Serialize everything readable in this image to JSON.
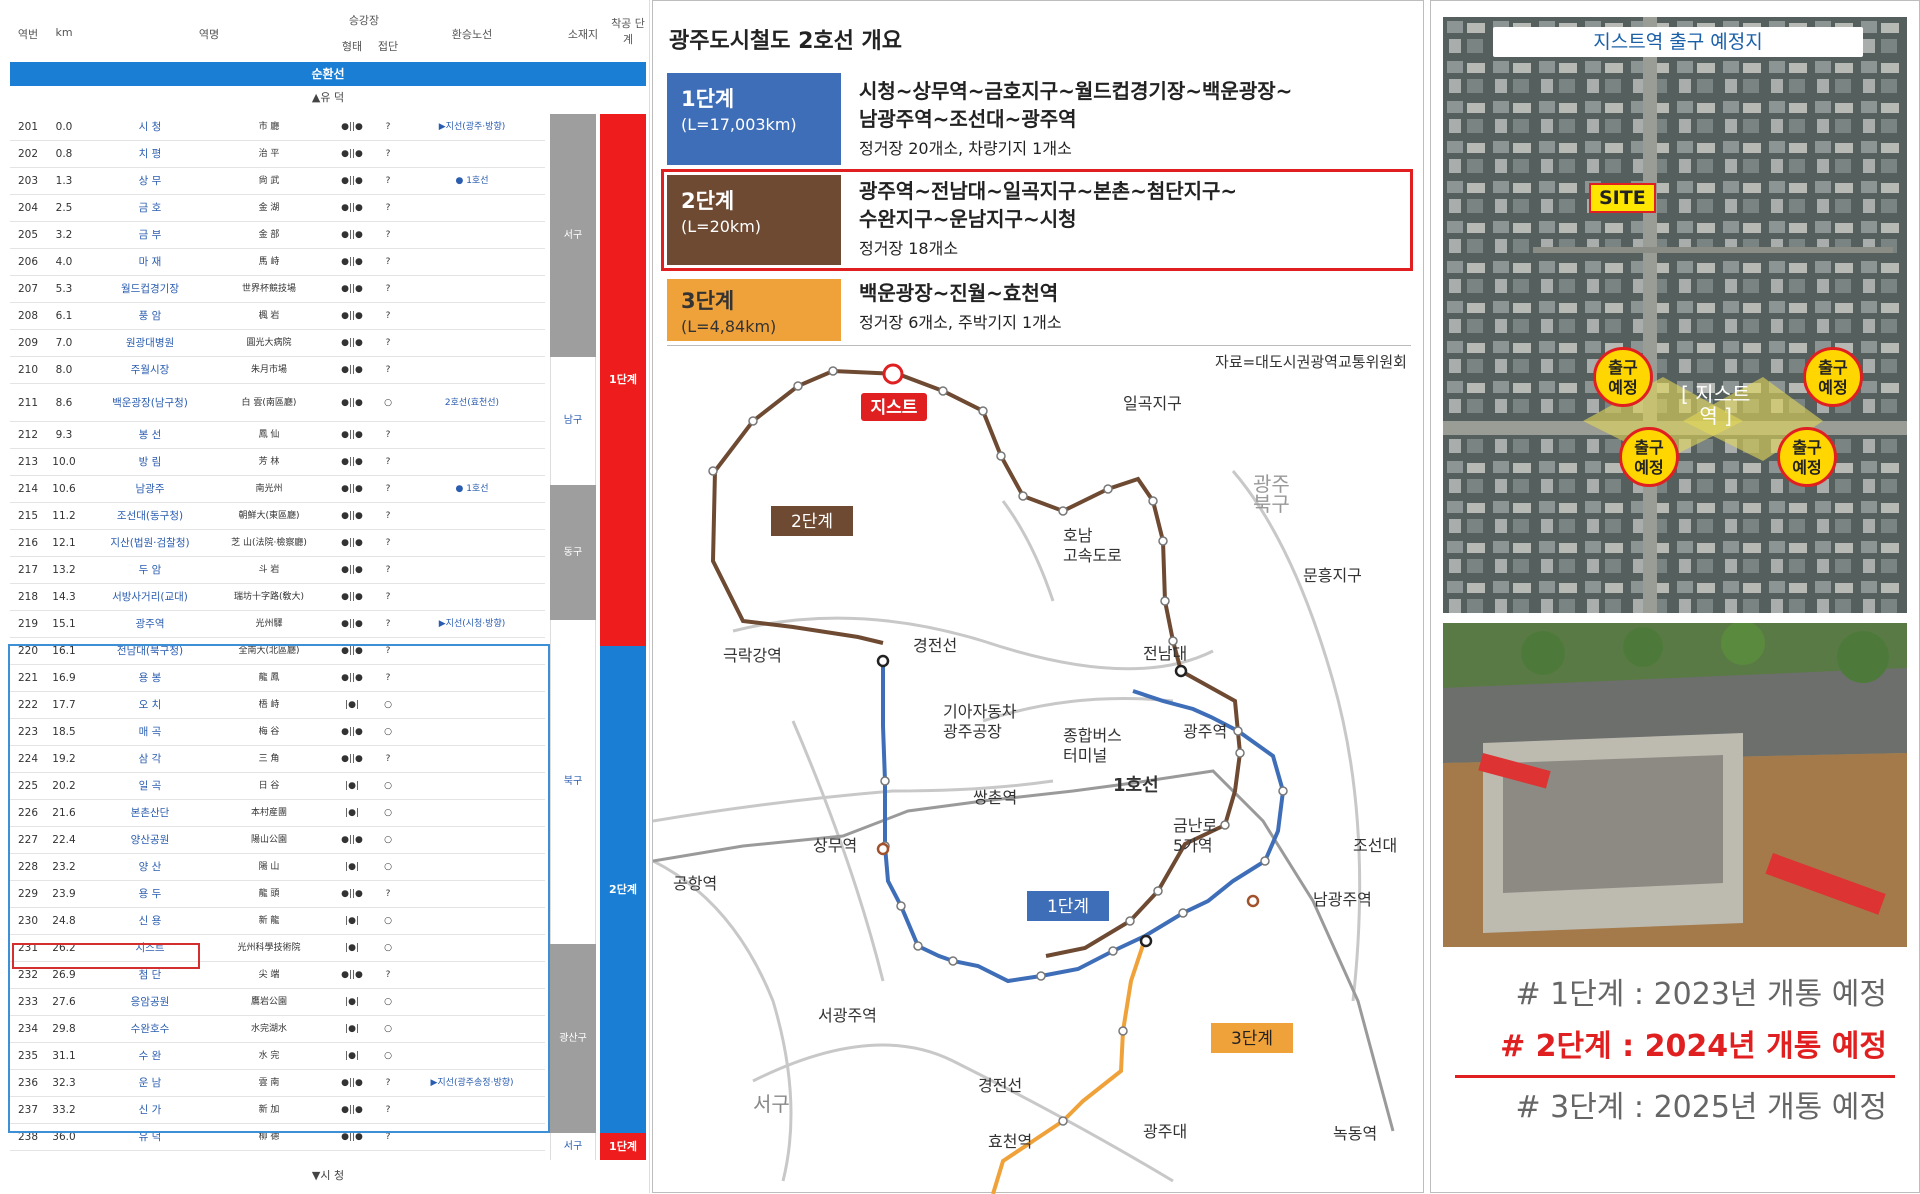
{
  "table": {
    "headers": {
      "no": "역번",
      "km": "km",
      "name": "역명",
      "platform": "승강장",
      "platform_a": "형태",
      "platform_b": "접단",
      "transfer": "환승노선",
      "district": "소재지",
      "stage": "착공 단계"
    },
    "loop_band": "순환선",
    "direction_top": "▲유 덕",
    "direction_bottom": "▼시 청",
    "rows": [
      {
        "no": "201",
        "km": "0.0",
        "name": "시 청",
        "hanja": "市 廳",
        "stop": "●||●",
        "q": "?",
        "tr": "▶지선(광주·방향)"
      },
      {
        "no": "202",
        "km": "0.8",
        "name": "치 평",
        "hanja": "治 平",
        "stop": "●||●",
        "q": "?",
        "tr": ""
      },
      {
        "no": "203",
        "km": "1.3",
        "name": "상 무",
        "hanja": "尙 武",
        "stop": "●||●",
        "q": "?",
        "tr": "● 1호선"
      },
      {
        "no": "204",
        "km": "2.5",
        "name": "금 호",
        "hanja": "金 湖",
        "stop": "●||●",
        "q": "?",
        "tr": ""
      },
      {
        "no": "205",
        "km": "3.2",
        "name": "금 부",
        "hanja": "金 部",
        "stop": "●||●",
        "q": "?",
        "tr": ""
      },
      {
        "no": "206",
        "km": "4.0",
        "name": "마 재",
        "hanja": "馬 峙",
        "stop": "●||●",
        "q": "?",
        "tr": ""
      },
      {
        "no": "207",
        "km": "5.3",
        "name": "월드컵경기장",
        "hanja": "世界杯競技場",
        "stop": "●||●",
        "q": "?",
        "tr": ""
      },
      {
        "no": "208",
        "km": "6.1",
        "name": "풍 암",
        "hanja": "楓 岩",
        "stop": "●||●",
        "q": "?",
        "tr": ""
      },
      {
        "no": "209",
        "km": "7.0",
        "name": "원광대병원",
        "hanja": "圓光大病院",
        "stop": "●||●",
        "q": "?",
        "tr": ""
      },
      {
        "no": "210",
        "km": "8.0",
        "name": "주월시장",
        "hanja": "朱月市場",
        "stop": "●||●",
        "q": "?",
        "tr": ""
      },
      {
        "no": "211",
        "km": "8.6",
        "name": "백운광장(남구청)",
        "hanja": "白 雲(南區廳)",
        "stop": "●||●",
        "q": "○",
        "tr": "2호선(효천선)"
      },
      {
        "no": "212",
        "km": "9.3",
        "name": "봉 선",
        "hanja": "鳳 仙",
        "stop": "●||●",
        "q": "?",
        "tr": ""
      },
      {
        "no": "213",
        "km": "10.0",
        "name": "방 림",
        "hanja": "芳 林",
        "stop": "●||●",
        "q": "?",
        "tr": ""
      },
      {
        "no": "214",
        "km": "10.6",
        "name": "남광주",
        "hanja": "南光州",
        "stop": "●||●",
        "q": "?",
        "tr": "● 1호선"
      },
      {
        "no": "215",
        "km": "11.2",
        "name": "조선대(동구청)",
        "hanja": "朝鮮大(東區廳)",
        "stop": "●||●",
        "q": "?",
        "tr": ""
      },
      {
        "no": "216",
        "km": "12.1",
        "name": "지산(법원·검찰청)",
        "hanja": "芝 山(法院·檢察廳)",
        "stop": "●||●",
        "q": "?",
        "tr": ""
      },
      {
        "no": "217",
        "km": "13.2",
        "name": "두 암",
        "hanja": "斗 岩",
        "stop": "●||●",
        "q": "?",
        "tr": ""
      },
      {
        "no": "218",
        "km": "14.3",
        "name": "서방사거리(교대)",
        "hanja": "瑞坊十字路(敎大)",
        "stop": "●||●",
        "q": "?",
        "tr": ""
      },
      {
        "no": "219",
        "km": "15.1",
        "name": "광주역",
        "hanja": "光州驛",
        "stop": "●||●",
        "q": "?",
        "tr": "▶지선(시청·방향)"
      },
      {
        "no": "220",
        "km": "16.1",
        "name": "전남대(북구청)",
        "hanja": "全南大(北區廳)",
        "stop": "●||●",
        "q": "?",
        "tr": ""
      },
      {
        "no": "221",
        "km": "16.9",
        "name": "용 봉",
        "hanja": "龍 鳳",
        "stop": "●||●",
        "q": "?",
        "tr": ""
      },
      {
        "no": "222",
        "km": "17.7",
        "name": "오 치",
        "hanja": "梧 峙",
        "stop": "|●|",
        "q": "○",
        "tr": ""
      },
      {
        "no": "223",
        "km": "18.5",
        "name": "매 곡",
        "hanja": "梅 谷",
        "stop": "●||●",
        "q": "○",
        "tr": ""
      },
      {
        "no": "224",
        "km": "19.2",
        "name": "삼 각",
        "hanja": "三 角",
        "stop": "●||●",
        "q": "?",
        "tr": ""
      },
      {
        "no": "225",
        "km": "20.2",
        "name": "일 곡",
        "hanja": "日 谷",
        "stop": "|●|",
        "q": "○",
        "tr": ""
      },
      {
        "no": "226",
        "km": "21.6",
        "name": "본촌산단",
        "hanja": "本村産團",
        "stop": "|●|",
        "q": "○",
        "tr": ""
      },
      {
        "no": "227",
        "km": "22.4",
        "name": "양산공원",
        "hanja": "陽山公園",
        "stop": "●||●",
        "q": "○",
        "tr": ""
      },
      {
        "no": "228",
        "km": "23.2",
        "name": "양 산",
        "hanja": "陽 山",
        "stop": "|●|",
        "q": "○",
        "tr": ""
      },
      {
        "no": "229",
        "km": "23.9",
        "name": "용 두",
        "hanja": "龍 頭",
        "stop": "●||●",
        "q": "?",
        "tr": ""
      },
      {
        "no": "230",
        "km": "24.8",
        "name": "신 용",
        "hanja": "新 龍",
        "stop": "|●|",
        "q": "○",
        "tr": ""
      },
      {
        "no": "231",
        "km": "26.2",
        "name": "지스트",
        "hanja": "光州科學技術院",
        "stop": "|●|",
        "q": "○",
        "tr": ""
      },
      {
        "no": "232",
        "km": "26.9",
        "name": "첨 단",
        "hanja": "尖 端",
        "stop": "●||●",
        "q": "?",
        "tr": ""
      },
      {
        "no": "233",
        "km": "27.6",
        "name": "응암공원",
        "hanja": "鷹岩公園",
        "stop": "|●|",
        "q": "○",
        "tr": ""
      },
      {
        "no": "234",
        "km": "29.8",
        "name": "수완호수",
        "hanja": "水完湖水",
        "stop": "|●|",
        "q": "○",
        "tr": ""
      },
      {
        "no": "235",
        "km": "31.1",
        "name": "수 완",
        "hanja": "水 完",
        "stop": "|●|",
        "q": "○",
        "tr": ""
      },
      {
        "no": "236",
        "km": "32.3",
        "name": "운 남",
        "hanja": "雲 南",
        "stop": "●||●",
        "q": "?",
        "tr": "▶지선(광주송정·방향)"
      },
      {
        "no": "237",
        "km": "33.2",
        "name": "신 가",
        "hanja": "新 加",
        "stop": "●||●",
        "q": "?",
        "tr": ""
      },
      {
        "no": "238",
        "km": "36.0",
        "name": "유 덕",
        "hanja": "柳 德",
        "stop": "●||●",
        "q": "?",
        "tr": ""
      }
    ],
    "districts": {
      "seo": "서구",
      "nam": "남구",
      "dong": "동구",
      "buk": "북구",
      "gwangsan": "광산구",
      "seo2": "서구"
    },
    "stages": {
      "s1": "1단계",
      "s2": "2단계",
      "s1b": "1단계"
    }
  },
  "overview": {
    "title": "광주도시철도 2호선 개요",
    "stages": [
      {
        "label": "1단계",
        "length": "(L=17,003km)",
        "route": "시청~상무역~금호지구~월드컵경기장~백운광장~\n남광주역~조선대~광주역",
        "facilities": "정거장 20개소, 차량기지 1개소",
        "color": "#3f6eb8"
      },
      {
        "label": "2단계",
        "length": "(L=20km)",
        "route": "광주역~전남대~일곡지구~본촌~첨단지구~\n수완지구~운남지구~시청",
        "facilities": "정거장 18개소",
        "color": "#6e4a32"
      },
      {
        "label": "3단계",
        "length": "(L=4,84km)",
        "route": "백운광장~진월~효천역",
        "facilities": "정거장 6개소, 주박기지 1개소",
        "color": "#f0a23a"
      }
    ],
    "source": "자료=대도시권광역교통위원회",
    "map_labels": {
      "gist": "지스트",
      "stage1": "1단계",
      "stage2": "2단계",
      "stage3": "3단계",
      "ilgok": "일곡지구",
      "gwangju_bukgu": "광주\n북구",
      "honam": "호남\n고속도로",
      "munheung": "문흥지구",
      "geukrak": "극락강역",
      "gyeongjeon": "경전선",
      "jeonnam": "전남대",
      "kia": "기아자동차\n광주공장",
      "terminal": "종합버스\n터미널",
      "gwangju_st": "광주역",
      "ssangchon": "쌍촌역",
      "line1": "1호선",
      "geumnamro": "금난로\n5가역",
      "chosun": "조선대",
      "sangmu": "상무역",
      "namgwangju": "남광주역",
      "airport": "공항역",
      "seogwangju": "서광주역",
      "gyeongjeon2": "경전선",
      "seogu": "서구",
      "hyocheon": "효천역",
      "gwangjudae": "광주대",
      "nokdong": "녹동역"
    }
  },
  "site": {
    "aerial_title": "지스트역 출구 예정지",
    "site_tag": "SITE",
    "exit_label": "출구\n예정",
    "station_label": "[ 지스트\n역 ]",
    "notes": [
      "# 1단계 : 2023년 개통 예정",
      "# 2단계 : 2024년 개통 예정",
      "# 3단계 : 2025년 개통 예정"
    ]
  },
  "colors": {
    "stage1": "#3f6eb8",
    "stage2": "#6e4a32",
    "stage3": "#f0a23a",
    "red": "#e02020",
    "band": "#1a7fd4"
  }
}
